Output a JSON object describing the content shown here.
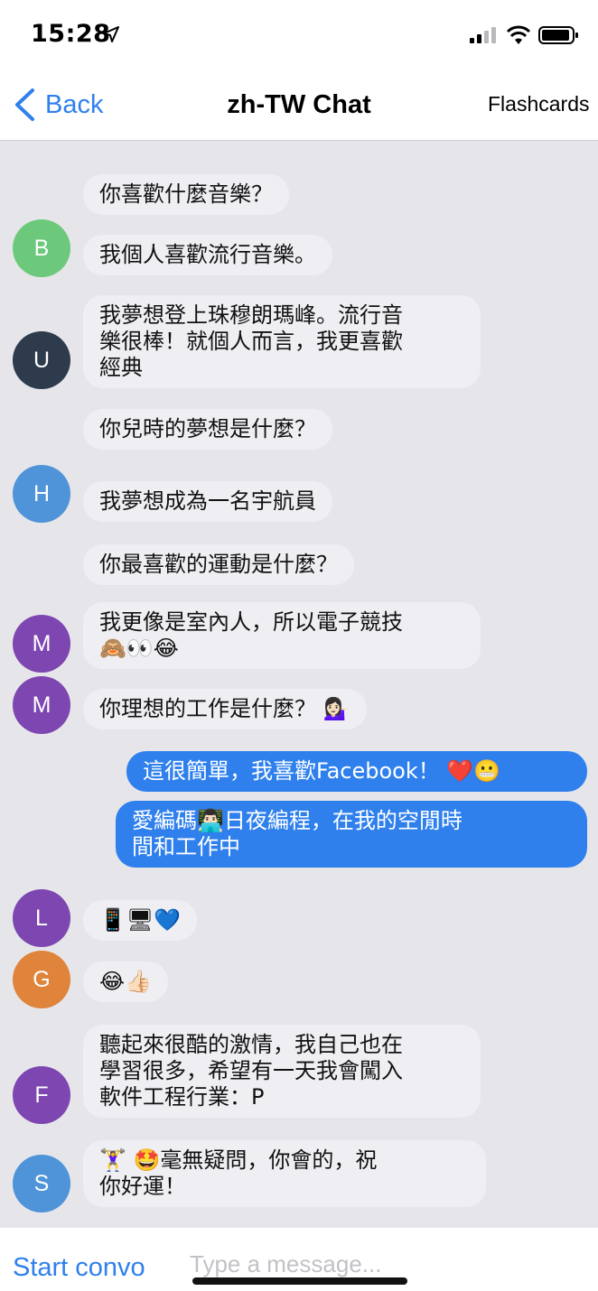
{
  "status_bar": {
    "time": "15:28"
  },
  "nav": {
    "back_label": "Back",
    "title": "zh-TW Chat",
    "flashcards_label": "Flashcards"
  },
  "messages": [
    {
      "text": "你喜歡什麼音樂？"
    },
    {
      "avatar": "B",
      "avatar_color": "#6cc97b",
      "text": "我個人喜歡流行音樂。"
    },
    {
      "avatar": "U",
      "avatar_color": "#2d3b4d",
      "lines": [
        "我夢想登上珠穆朗瑪峰。流行音",
        "樂很棒！就個人而言，我更喜歡",
        "經典"
      ]
    },
    {
      "text": "你兒時的夢想是什麼？"
    },
    {
      "avatar": "H",
      "avatar_color": "#4f93d9",
      "text": "我夢想成為一名宇航員"
    },
    {
      "text": "你最喜歡的運動是什麼？"
    },
    {
      "avatar": "M",
      "avatar_color": "#7d46b0",
      "lines": [
        "我更像是室內人，所以電子競技",
        "🙈👀😂"
      ]
    },
    {
      "avatar": "M",
      "avatar_color": "#7d46b0",
      "text": "你理想的工作是什麼？ 💁🏻‍♀️"
    },
    {
      "side": "right",
      "text": "這很簡單，我喜歡Facebook！ ❤️😬"
    },
    {
      "side": "right",
      "lines": [
        "愛編碼👨🏻‍💻日夜編程，在我的空閒時",
        "間和工作中"
      ]
    },
    {
      "avatar": "L",
      "avatar_color": "#7d46b0",
      "text": "📱🖥💙"
    },
    {
      "avatar": "G",
      "avatar_color": "#e0843c",
      "text": "😂👍🏻"
    },
    {
      "avatar": "F",
      "avatar_color": "#7d46b0",
      "lines": [
        "聽起來很酷的激情，我自己也在",
        "學習很多，希望有一天我會闖入",
        "軟件工程行業：P"
      ]
    },
    {
      "avatar": "S",
      "avatar_color": "#4f93d9",
      "lines": [
        "🏋️‍♀️ 🤩毫無疑問，你會的，祝",
        "你好運！"
      ]
    }
  ],
  "footer": {
    "start_label": "Start convo",
    "input_placeholder": "Type a message..."
  },
  "colors": {
    "accent": "#2f80ed",
    "incoming_bubble": "#efeff3",
    "background": "#e6e6ea"
  }
}
